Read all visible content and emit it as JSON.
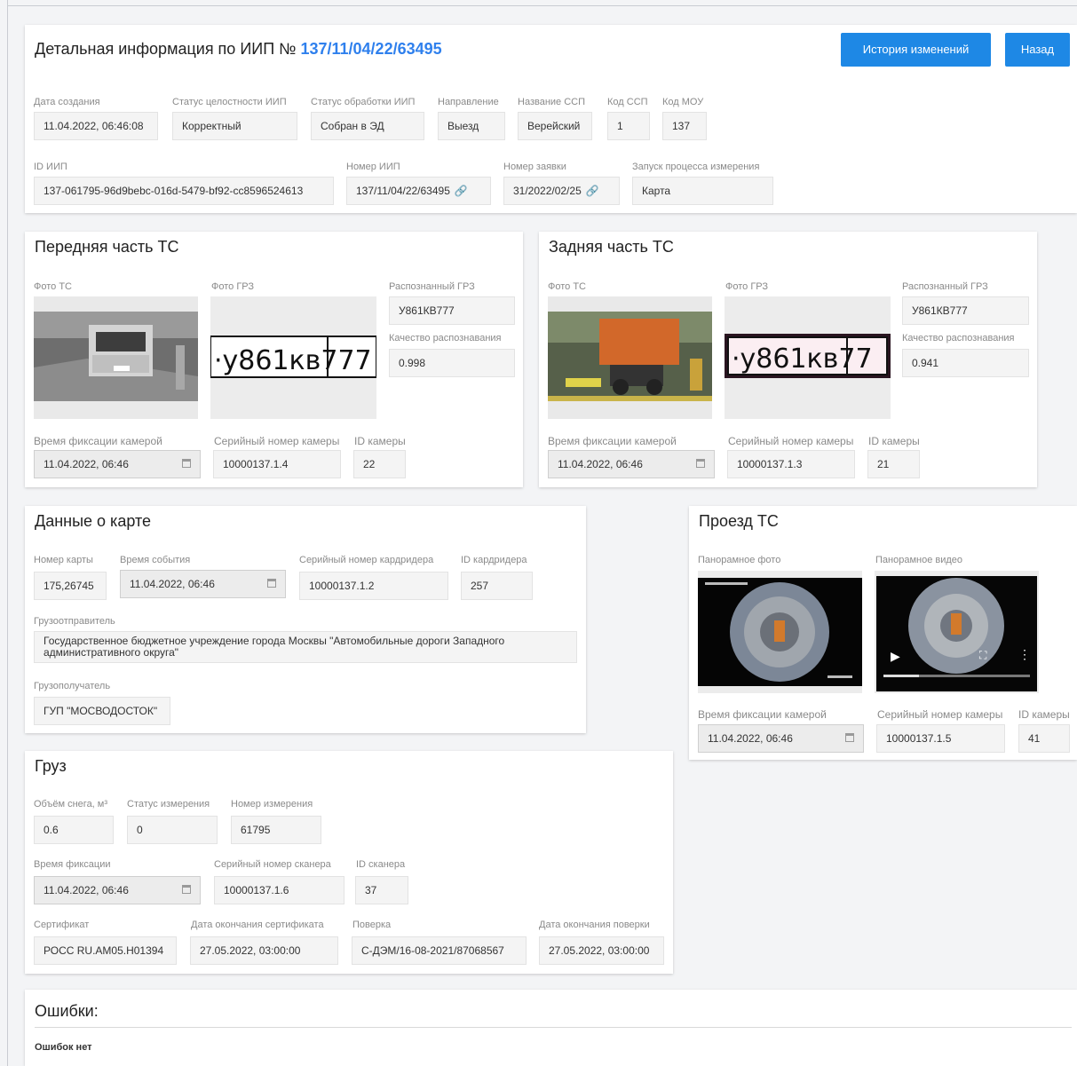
{
  "header": {
    "title_prefix": "Детальная информация по ИИП №",
    "iip_number": "137/11/04/22/63495",
    "history_button": "История изменений",
    "back_button": "Назад",
    "fields": [
      {
        "label": "Дата создания",
        "value": "11.04.2022, 06:46:08"
      },
      {
        "label": "Статус целостности ИИП",
        "value": "Корректный"
      },
      {
        "label": "Статус обработки ИИП",
        "value": "Собран в ЭД"
      },
      {
        "label": "Направление",
        "value": "Выезд"
      },
      {
        "label": "Название ССП",
        "value": "Верейский"
      },
      {
        "label": "Код ССП",
        "value": "1"
      },
      {
        "label": "Код МОУ",
        "value": "137"
      },
      {
        "label": "ID ИИП",
        "value": "137-061795-96d9bebc-016d-5479-bf92-cc8596524613"
      },
      {
        "label": "Номер ИИП",
        "value": "137/11/04/22/63495"
      },
      {
        "label": "Номер заявки",
        "value": "31/2022/02/25"
      },
      {
        "label": "Запуск процесса измерения",
        "value": "Карта"
      }
    ]
  },
  "front": {
    "title": "Передняя часть ТС",
    "photo_label": "Фото ТС",
    "plate_photo_label": "Фото ГРЗ",
    "recognized_label": "Распознанный ГРЗ",
    "recognized_value": "У861КВ777",
    "quality_label": "Качество распознавания",
    "quality_value": "0.998",
    "plate_image_text": "·у861кв777",
    "time_label": "Время фиксации камерой",
    "time_value": "11.04.2022, 06:46",
    "serial_label": "Серийный номер камеры",
    "serial_value": "10000137.1.4",
    "camera_id_label": "ID камеры",
    "camera_id_value": "22"
  },
  "rear": {
    "title": "Задняя часть ТС",
    "photo_label": "Фото ТС",
    "plate_photo_label": "Фото ГРЗ",
    "recognized_label": "Распознанный ГРЗ",
    "recognized_value": "У861КВ777",
    "quality_label": "Качество распознавания",
    "quality_value": "0.941",
    "plate_image_text": "·у861кв77",
    "time_label": "Время фиксации камерой",
    "time_value": "11.04.2022, 06:46",
    "serial_label": "Серийный номер камеры",
    "serial_value": "10000137.1.3",
    "camera_id_label": "ID камеры",
    "camera_id_value": "21"
  },
  "card": {
    "title": "Данные о карте",
    "card_number_label": "Номер карты",
    "card_number_value": "175,26745",
    "event_time_label": "Время события",
    "event_time_value": "11.04.2022, 06:46",
    "reader_serial_label": "Серийный номер кардридера",
    "reader_serial_value": "10000137.1.2",
    "reader_id_label": "ID кардридера",
    "reader_id_value": "257",
    "shipper_label": "Грузоотправитель",
    "shipper_value": "Государственное бюджетное учреждение города Москвы \"Автомобильные дороги Западного административного округа\"",
    "consignee_label": "Грузополучатель",
    "consignee_value": "ГУП \"МОСВОДОСТОК\""
  },
  "passage": {
    "title": "Проезд ТС",
    "pano_photo_label": "Панорамное фото",
    "pano_video_label": "Панорамное видео",
    "time_label": "Время фиксации камерой",
    "time_value": "11.04.2022, 06:46",
    "serial_label": "Серийный номер камеры",
    "serial_value": "10000137.1.5",
    "camera_id_label": "ID камеры",
    "camera_id_value": "41"
  },
  "cargo": {
    "title": "Груз",
    "volume_label": "Объём снега, м³",
    "volume_value": "0.6",
    "status_label": "Статус измерения",
    "status_value": "0",
    "measure_number_label": "Номер измерения",
    "measure_number_value": "61795",
    "time_label": "Время фиксации",
    "time_value": "11.04.2022, 06:46",
    "scanner_serial_label": "Серийный номер сканера",
    "scanner_serial_value": "10000137.1.6",
    "scanner_id_label": "ID сканера",
    "scanner_id_value": "37",
    "cert_label": "Сертификат",
    "cert_value": "РОСС RU.АМ05.Н01394",
    "cert_end_label": "Дата окончания сертификата",
    "cert_end_value": "27.05.2022, 03:00:00",
    "verify_label": "Поверка",
    "verify_value": "С-ДЭМ/16-08-2021/87068567",
    "verify_end_label": "Дата окончания поверки",
    "verify_end_value": "27.05.2022, 03:00:00"
  },
  "errors": {
    "title": "Ошибки:",
    "text": "Ошибок нет"
  },
  "colors": {
    "accent": "#1e88e5",
    "link": "#2f80ed"
  }
}
